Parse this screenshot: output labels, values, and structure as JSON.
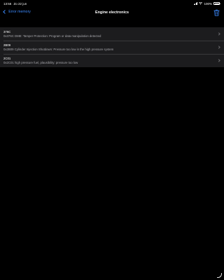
{
  "status_bar": {
    "time": "13:56",
    "date": "Zo 22 jun",
    "battery_percent": "100%",
    "battery_level": 1.0
  },
  "nav": {
    "back_label": "Error memory",
    "title": "Engine electronics",
    "trash_icon": "trash-icon",
    "accent_color": "#3d8bff"
  },
  "errors": [
    {
      "code": "376C",
      "description": "0x376C DME: Tamper Protection: Program or data manipulation detected"
    },
    {
      "code": "2B09",
      "description": "0x2B09 Cylinder Injection Shutdown: Pressure too low in the high pressure system"
    },
    {
      "code": "2C01",
      "description": "0x2C01 high pressure fuel, plausibility: pressure too low"
    }
  ]
}
